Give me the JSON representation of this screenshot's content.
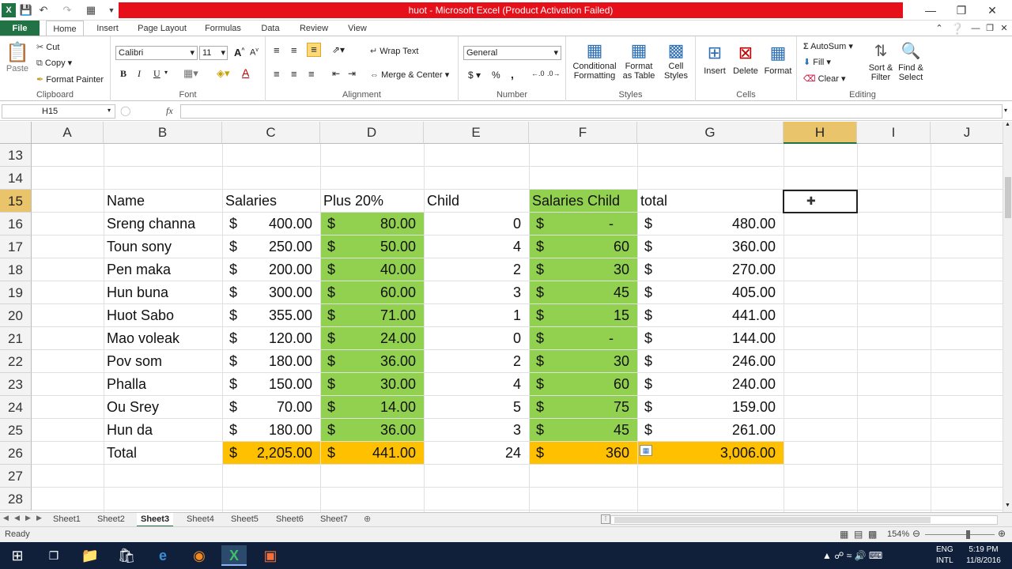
{
  "window": {
    "title": "huot  -  Microsoft Excel (Product Activation Failed)",
    "controls": [
      "minimize",
      "restore",
      "close"
    ]
  },
  "ribbon_tabs": [
    "File",
    "Home",
    "Insert",
    "Page Layout",
    "Formulas",
    "Data",
    "Review",
    "View"
  ],
  "ribbon": {
    "clipboard": {
      "paste": "Paste",
      "cut": "Cut",
      "copy": "Copy",
      "format_painter": "Format Painter",
      "label": "Clipboard"
    },
    "font": {
      "name": "Calibri",
      "size": "11",
      "bold": "B",
      "italic": "I",
      "underline": "U",
      "label": "Font"
    },
    "alignment": {
      "wrap_text": "Wrap Text",
      "merge_center": "Merge & Center",
      "label": "Alignment"
    },
    "number": {
      "format": "General",
      "currency": "$",
      "percent": "%",
      "comma": ",",
      "label": "Number"
    },
    "styles": {
      "conditional": "Conditional Formatting",
      "format_table": "Format as Table",
      "cell_styles": "Cell Styles",
      "label": "Styles"
    },
    "cells": {
      "insert": "Insert",
      "delete": "Delete",
      "format": "Format",
      "label": "Cells"
    },
    "editing": {
      "autosum": "AutoSum",
      "fill": "Fill",
      "clear": "Clear",
      "sort_filter": "Sort & Filter",
      "find_select": "Find & Select",
      "label": "Editing"
    }
  },
  "formula_bar": {
    "name_box": "H15",
    "fx": "fx",
    "formula": ""
  },
  "columns": [
    "A",
    "B",
    "C",
    "D",
    "E",
    "F",
    "G",
    "H",
    "I",
    "J"
  ],
  "rows": [
    "13",
    "14",
    "15",
    "16",
    "17",
    "18",
    "19",
    "20",
    "21",
    "22",
    "23",
    "24",
    "25",
    "26",
    "27",
    "28"
  ],
  "headers": {
    "name": "Name",
    "salaries": "Salaries",
    "plus20": "Plus 20%",
    "child": "Child",
    "salaries_child": "Salaries Child",
    "total": "total"
  },
  "data_rows": [
    {
      "name": "Sreng channa",
      "salary": "400.00",
      "plus": "80.00",
      "child": "0",
      "schild": "-",
      "total": "480.00"
    },
    {
      "name": "Toun sony",
      "salary": "250.00",
      "plus": "50.00",
      "child": "4",
      "schild": "60",
      "total": "360.00"
    },
    {
      "name": "Pen maka",
      "salary": "200.00",
      "plus": "40.00",
      "child": "2",
      "schild": "30",
      "total": "270.00"
    },
    {
      "name": "Hun buna",
      "salary": "300.00",
      "plus": "60.00",
      "child": "3",
      "schild": "45",
      "total": "405.00"
    },
    {
      "name": "Huot Sabo",
      "salary": "355.00",
      "plus": "71.00",
      "child": "1",
      "schild": "15",
      "total": "441.00"
    },
    {
      "name": "Mao voleak",
      "salary": "120.00",
      "plus": "24.00",
      "child": "0",
      "schild": "-",
      "total": "144.00"
    },
    {
      "name": "Pov som",
      "salary": "180.00",
      "plus": "36.00",
      "child": "2",
      "schild": "30",
      "total": "246.00"
    },
    {
      "name": "Phalla",
      "salary": "150.00",
      "plus": "30.00",
      "child": "4",
      "schild": "60",
      "total": "240.00"
    },
    {
      "name": "Ou Srey",
      "salary": "70.00",
      "plus": "14.00",
      "child": "5",
      "schild": "75",
      "total": "159.00"
    },
    {
      "name": "Hun da",
      "salary": "180.00",
      "plus": "36.00",
      "child": "3",
      "schild": "45",
      "total": "261.00"
    }
  ],
  "total_row": {
    "label": "Total",
    "salary": "2,205.00",
    "plus": "441.00",
    "child": "24",
    "schild": "360",
    "total": "3,006.00"
  },
  "currency_symbol": "$",
  "sheets": [
    "Sheet1",
    "Sheet2",
    "Sheet3",
    "Sheet4",
    "Sheet5",
    "Sheet6",
    "Sheet7"
  ],
  "active_sheet": "Sheet3",
  "status": {
    "mode": "Ready",
    "zoom": "154%"
  },
  "taskbar": {
    "lang1": "ENG",
    "lang2": "INTL",
    "time": "5:19 PM",
    "date": "11/8/2016"
  },
  "colors": {
    "green_fill": "#92d050",
    "orange_fill": "#ffc000",
    "excel_green": "#217346",
    "title_red": "#e5101a"
  }
}
